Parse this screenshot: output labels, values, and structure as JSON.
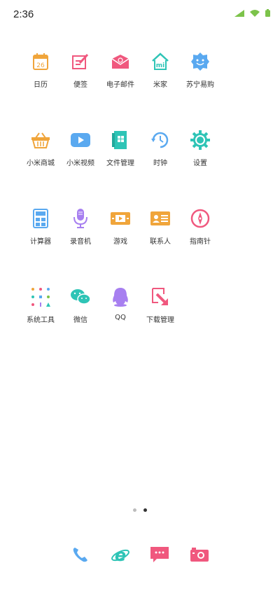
{
  "status": {
    "time": "2:36"
  },
  "apps": [
    [
      "日历",
      "便签",
      "电子邮件",
      "米家",
      "苏宁易购"
    ],
    [
      "小米商城",
      "小米视频",
      "文件管理",
      "时钟",
      "设置"
    ],
    [
      "计算器",
      "录音机",
      "游戏",
      "联系人",
      "指南针"
    ],
    [
      "系统工具",
      "微信",
      "QQ",
      "下载管理"
    ]
  ],
  "calendar_day": "26",
  "pager": {
    "pages": 2,
    "current": 2
  },
  "dock": [
    "phone",
    "browser",
    "messages",
    "camera"
  ],
  "colors": {
    "orange": "#f0a53b",
    "pink": "#f0587e",
    "teal": "#2ec4b6",
    "blue": "#5aa9f0",
    "purple": "#a77ff0",
    "green": "#7cc34a"
  }
}
